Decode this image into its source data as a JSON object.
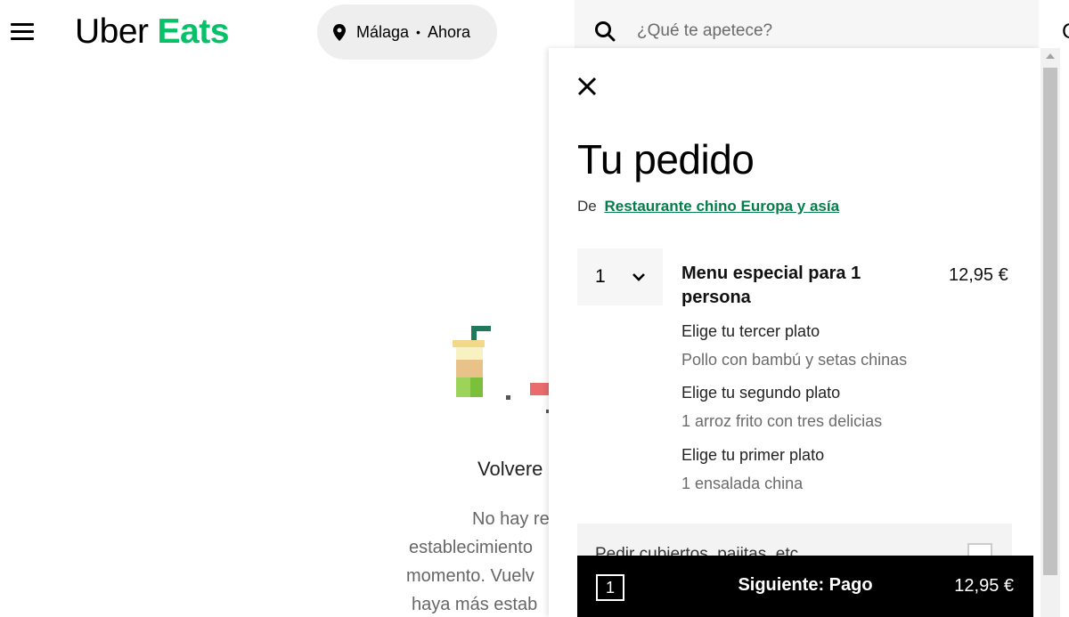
{
  "header": {
    "logo_uber": "Uber",
    "logo_eats": "Eats",
    "brand_color": "#06c167",
    "location_city": "Málaga",
    "location_separator": "•",
    "location_time": "Ahora",
    "search_placeholder": "¿Qué te apetece?",
    "edge_glyph": "C"
  },
  "background": {
    "title": "Volvere",
    "lines": [
      "No hay re",
      "establecimiento",
      "momento. Vuelv",
      "haya más estab"
    ]
  },
  "cart": {
    "title": "Tu pedido",
    "from_prefix": "De",
    "restaurant": "Restaurante chino Europa y asía",
    "item": {
      "quantity": "1",
      "name": "Menu especial para 1 persona",
      "price": "12,95 €",
      "options": [
        {
          "label": "Elige tu tercer plato",
          "value": "Pollo con bambú y setas chinas"
        },
        {
          "label": "Elige tu segundo plato",
          "value": "1 arroz frito con tres delicias"
        },
        {
          "label": "Elige tu primer plato",
          "value": "1 ensalada china"
        }
      ]
    },
    "cutlery_label": "Pedir cubiertos, pajitas, etc.",
    "checkout": {
      "count": "1",
      "label": "Siguiente: Pago",
      "total": "12,95 €"
    }
  }
}
